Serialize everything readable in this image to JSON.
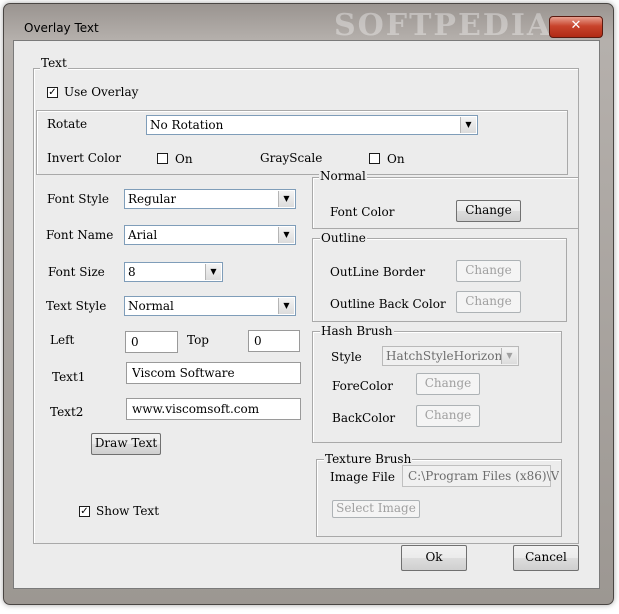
{
  "window": {
    "title": "Overlay Text",
    "close_glyph": "✕",
    "watermark": "SOFTPEDIA"
  },
  "text_group": {
    "legend": "Text",
    "use_overlay": {
      "label": "Use Overlay",
      "checked": true
    },
    "rotate_label": "Rotate",
    "rotate_value": "No Rotation",
    "invert_color_label": "Invert Color",
    "invert_on_label": "On",
    "invert_checked": false,
    "grayscale_label": "GrayScale",
    "grayscale_on_label": "On",
    "grayscale_checked": false
  },
  "font": {
    "style_label": "Font Style",
    "style_value": "Regular",
    "name_label": "Font Name",
    "name_value": "Arial",
    "size_label": "Font Size",
    "size_value": "8",
    "text_style_label": "Text Style",
    "text_style_value": "Normal",
    "left_label": "Left",
    "left_value": "0",
    "top_label": "Top",
    "top_value": "0",
    "text1_label": "Text1",
    "text1_value": "Viscom Software",
    "text2_label": "Text2",
    "text2_value": "www.viscomsoft.com",
    "draw_text_button": "Draw Text",
    "show_text": {
      "label": "Show Text",
      "checked": true
    }
  },
  "normal_group": {
    "legend": "Normal",
    "font_color_label": "Font Color",
    "change_button": "Change"
  },
  "outline_group": {
    "legend": "Outline",
    "border_label": "OutLine Border",
    "border_button": "Change",
    "back_label": "Outline Back Color",
    "back_button": "Change"
  },
  "hash_group": {
    "legend": "Hash Brush",
    "style_label": "Style",
    "style_value": "HatchStyleHorizonta",
    "fore_label": "ForeColor",
    "fore_button": "Change",
    "back_label": "BackColor",
    "back_button": "Change"
  },
  "texture_group": {
    "legend": "Texture Brush",
    "image_file_label": "Image File",
    "image_file_value": "C:\\Program Files (x86)\\V",
    "select_image_button": "Select Image"
  },
  "footer": {
    "ok": "Ok",
    "cancel": "Cancel"
  }
}
